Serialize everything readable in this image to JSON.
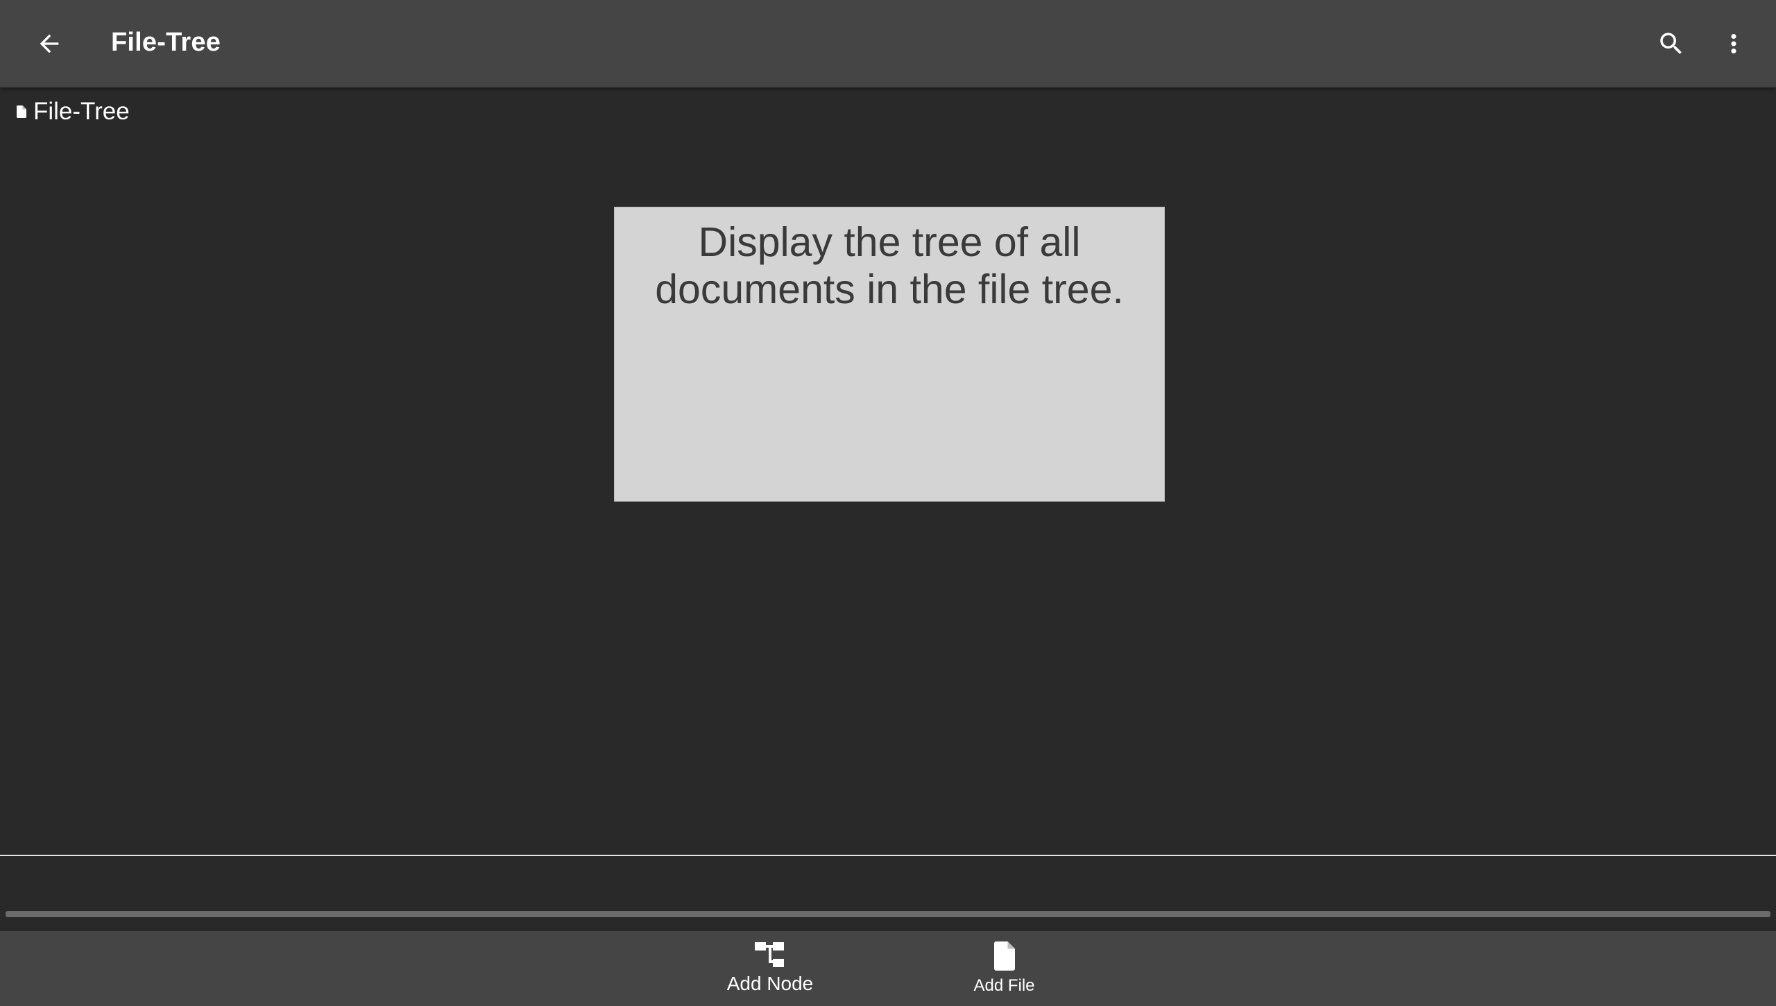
{
  "app_bar": {
    "title": "File-Tree",
    "back_icon": "arrow-back-icon",
    "search_icon": "search-icon",
    "more_icon": "more-vert-icon"
  },
  "breadcrumb": {
    "icon": "file-icon",
    "label": "File-Tree"
  },
  "info_box": {
    "text": "Display the tree of all documents in the file tree."
  },
  "bottom_bar": {
    "add_node": {
      "label": "Add Node",
      "icon": "node-tree-icon"
    },
    "add_file": {
      "label": "Add File",
      "icon": "file-icon"
    }
  },
  "colors": {
    "app_bar": "#454545",
    "background": "#292929",
    "info_box": "#d4d4d4",
    "text_light": "#ffffff",
    "text_dark": "#3a3a3a"
  }
}
